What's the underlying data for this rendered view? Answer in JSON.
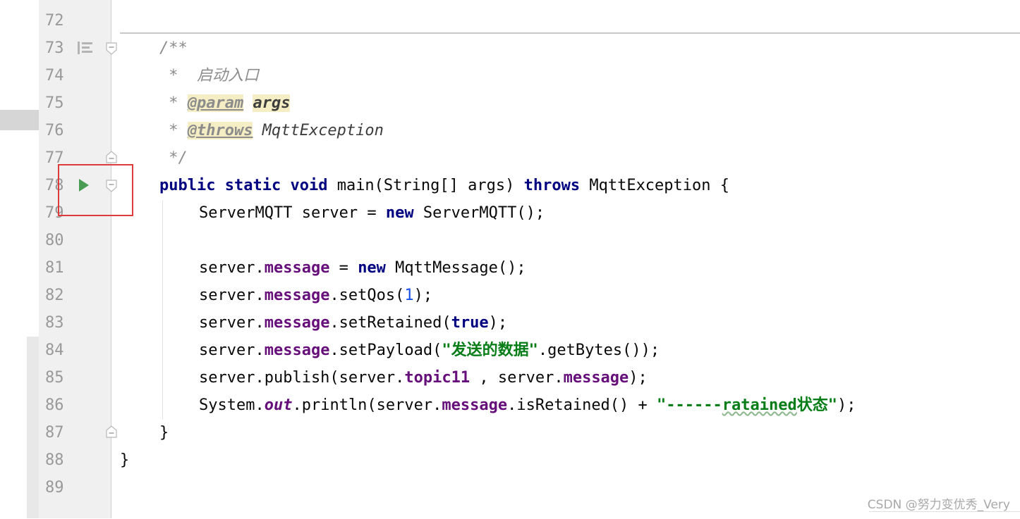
{
  "editor": {
    "watermark": "CSDN @努力变优秀_Very"
  },
  "lines": [
    {
      "number": "72",
      "tokens": []
    },
    {
      "number": "73",
      "tokens": [
        {
          "t": "/**",
          "c": "doc"
        }
      ]
    },
    {
      "number": "74",
      "tokens": [
        {
          "t": " *  启动入口",
          "c": "doc"
        }
      ]
    },
    {
      "number": "75",
      "tokens": [
        {
          "t": " * ",
          "c": "doc"
        },
        {
          "t": "@param",
          "c": "doctag"
        },
        {
          "t": " ",
          "c": "doc"
        },
        {
          "t": "args",
          "c": "docparam"
        }
      ]
    },
    {
      "number": "76",
      "tokens": [
        {
          "t": " * ",
          "c": "doc"
        },
        {
          "t": "@throws",
          "c": "doctag"
        },
        {
          "t": " ",
          "c": "doc"
        },
        {
          "t": "MqttException",
          "c": "doctype"
        }
      ]
    },
    {
      "number": "77",
      "tokens": [
        {
          "t": " */",
          "c": "doc"
        }
      ]
    },
    {
      "number": "78",
      "tokens": [
        {
          "t": "public",
          "c": "keyword"
        },
        {
          "t": " ",
          "c": "punct"
        },
        {
          "t": "static",
          "c": "keyword"
        },
        {
          "t": " ",
          "c": "punct"
        },
        {
          "t": "void",
          "c": "keyword"
        },
        {
          "t": " main(String[] args) ",
          "c": "ident"
        },
        {
          "t": "throws",
          "c": "keyword"
        },
        {
          "t": " MqttException {",
          "c": "ident"
        }
      ]
    },
    {
      "number": "79",
      "tokens": [
        {
          "t": "ServerMQTT server = ",
          "c": "ident"
        },
        {
          "t": "new",
          "c": "keyword"
        },
        {
          "t": " ServerMQTT();",
          "c": "ident"
        }
      ]
    },
    {
      "number": "80",
      "tokens": []
    },
    {
      "number": "81",
      "tokens": [
        {
          "t": "server.",
          "c": "ident"
        },
        {
          "t": "message",
          "c": "field"
        },
        {
          "t": " = ",
          "c": "ident"
        },
        {
          "t": "new",
          "c": "keyword"
        },
        {
          "t": " MqttMessage();",
          "c": "ident"
        }
      ]
    },
    {
      "number": "82",
      "tokens": [
        {
          "t": "server.",
          "c": "ident"
        },
        {
          "t": "message",
          "c": "field"
        },
        {
          "t": ".setQos(",
          "c": "ident"
        },
        {
          "t": "1",
          "c": "number"
        },
        {
          "t": ");",
          "c": "ident"
        }
      ]
    },
    {
      "number": "83",
      "tokens": [
        {
          "t": "server.",
          "c": "ident"
        },
        {
          "t": "message",
          "c": "field"
        },
        {
          "t": ".setRetained(",
          "c": "ident"
        },
        {
          "t": "true",
          "c": "keyword"
        },
        {
          "t": ");",
          "c": "ident"
        }
      ]
    },
    {
      "number": "84",
      "tokens": [
        {
          "t": "server.",
          "c": "ident"
        },
        {
          "t": "message",
          "c": "field"
        },
        {
          "t": ".setPayload(",
          "c": "ident"
        },
        {
          "t": "\"发送的数据\"",
          "c": "string"
        },
        {
          "t": ".getBytes());",
          "c": "ident"
        }
      ]
    },
    {
      "number": "85",
      "tokens": [
        {
          "t": "server.publish(server.",
          "c": "ident"
        },
        {
          "t": "topic11",
          "c": "field"
        },
        {
          "t": " , server.",
          "c": "ident"
        },
        {
          "t": "message",
          "c": "field"
        },
        {
          "t": ");",
          "c": "ident"
        }
      ]
    },
    {
      "number": "86",
      "tokens": [
        {
          "t": "System.",
          "c": "ident"
        },
        {
          "t": "out",
          "c": "static"
        },
        {
          "t": ".println(server.",
          "c": "ident"
        },
        {
          "t": "message",
          "c": "field"
        },
        {
          "t": ".isRetained() + ",
          "c": "ident"
        },
        {
          "t": "\"------",
          "c": "string"
        },
        {
          "t": "ratained",
          "c": "string typo"
        },
        {
          "t": "状态\"",
          "c": "string"
        },
        {
          "t": ");",
          "c": "ident"
        }
      ]
    },
    {
      "number": "87",
      "tokens": [
        {
          "t": "}",
          "c": "ident"
        }
      ]
    },
    {
      "number": "88",
      "tokens": [
        {
          "t": "}",
          "c": "ident"
        }
      ]
    },
    {
      "number": "89",
      "tokens": []
    }
  ],
  "gutter": {
    "run_icon": "run-triangle-icon",
    "annotation_icon": "doc-render-icon",
    "fold_icons": [
      "fold-start-icon",
      "fold-end-icon"
    ],
    "highlight_color": "#e03b3b"
  }
}
